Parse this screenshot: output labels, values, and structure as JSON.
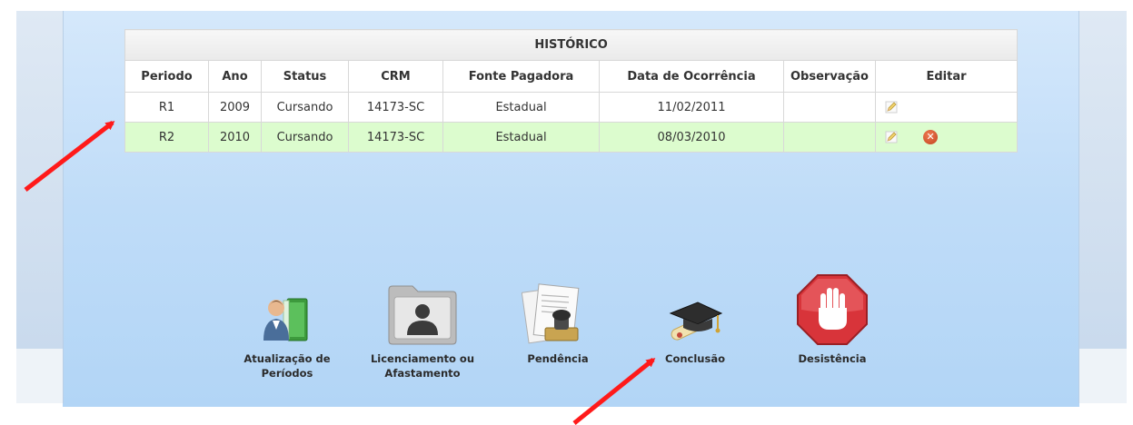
{
  "table": {
    "caption": "HISTÓRICO",
    "columns": [
      "Periodo",
      "Ano",
      "Status",
      "CRM",
      "Fonte Pagadora",
      "Data de Ocorrência",
      "Observação",
      "Editar"
    ],
    "rows": [
      {
        "periodo": "R1",
        "ano": "2009",
        "status": "Cursando",
        "crm": "14173-SC",
        "fonte": "Estadual",
        "data": "11/02/2011",
        "observacao": "",
        "can_delete": false
      },
      {
        "periodo": "R2",
        "ano": "2010",
        "status": "Cursando",
        "crm": "14173-SC",
        "fonte": "Estadual",
        "data": "08/03/2010",
        "observacao": "",
        "can_delete": true
      }
    ],
    "row_highlight_color": "#dcfcce"
  },
  "actions": [
    {
      "label_line1": "Atualização de",
      "label_line2": "Períodos",
      "icon": "person-book-icon"
    },
    {
      "label_line1": "Licenciamento ou",
      "label_line2": "Afastamento",
      "icon": "user-folder-icon"
    },
    {
      "label_line1": "Pendência",
      "label_line2": "",
      "icon": "documents-stamp-icon"
    },
    {
      "label_line1": "Conclusão",
      "label_line2": "",
      "icon": "graduation-cap-icon"
    },
    {
      "label_line1": "Desistência",
      "label_line2": "",
      "icon": "stop-hand-icon"
    }
  ],
  "annotations": {
    "arrow_color": "#ff1a1a"
  }
}
